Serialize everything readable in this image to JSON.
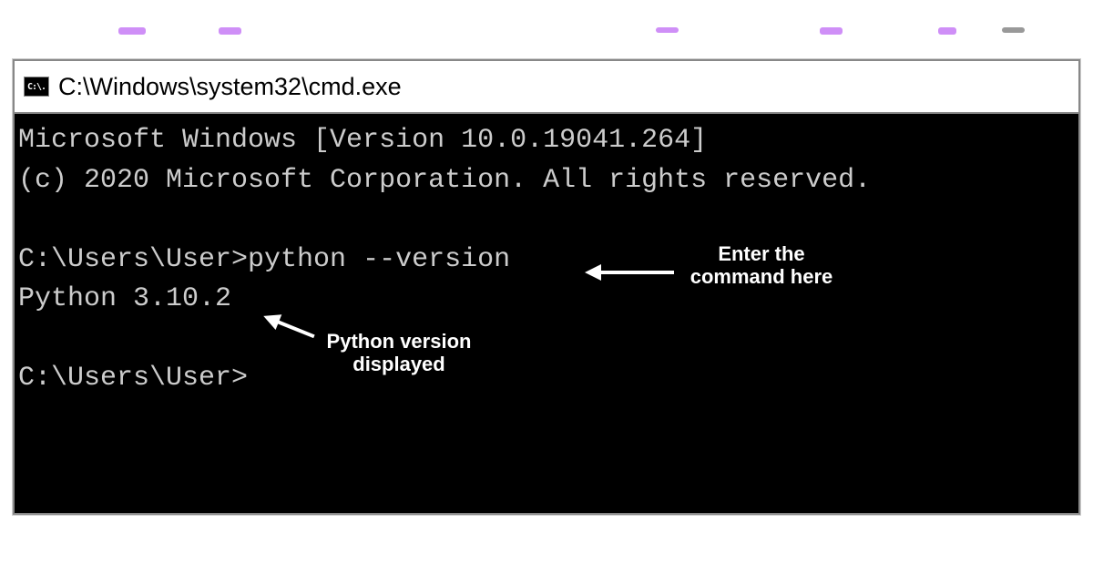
{
  "window": {
    "icon_glyph": "C:\\.",
    "title": "C:\\Windows\\system32\\cmd.exe"
  },
  "terminal": {
    "line1": "Microsoft Windows [Version 10.0.19041.264]",
    "line2": "(c) 2020 Microsoft Corporation. All rights reserved.",
    "prompt1": "C:\\Users\\User>",
    "command1": "python --version",
    "output1": "Python 3.10.2",
    "prompt2": "C:\\Users\\User>"
  },
  "annotations": {
    "enter_command": "Enter the command here",
    "version_displayed": "Python version displayed"
  }
}
